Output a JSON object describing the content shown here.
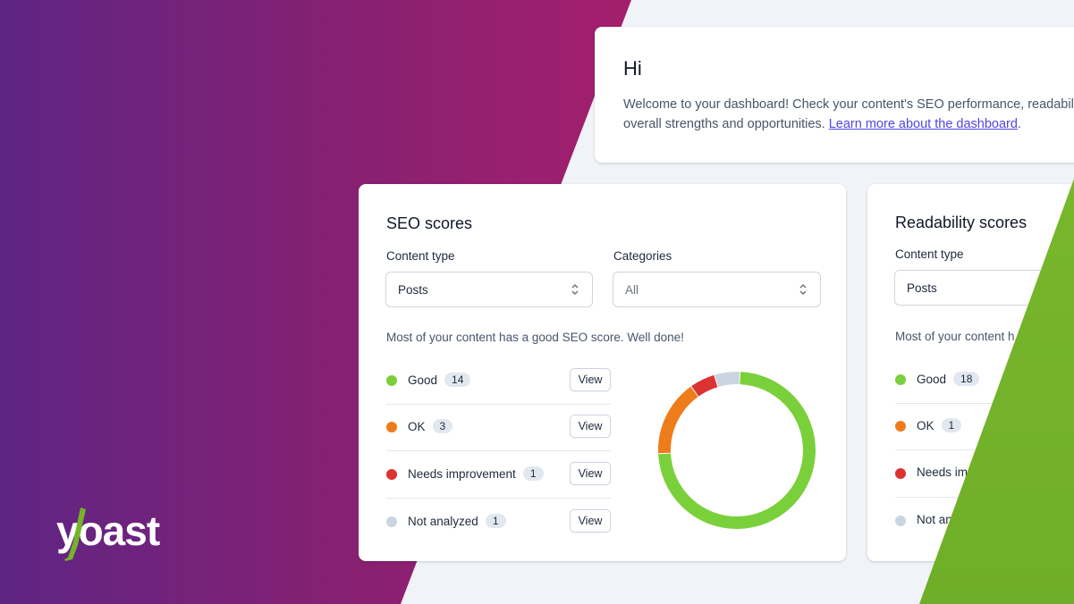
{
  "colors": {
    "good": "#7ad03a",
    "ok": "#ee7c1b",
    "bad": "#dc3232",
    "not_analyzed": "#cbd5e1",
    "brand_purple": "#a4286a",
    "brand_green": "#77b227",
    "link": "#4f46e5"
  },
  "logo": {
    "text": "yoast"
  },
  "welcome": {
    "title": "Hi",
    "text_line1": "Welcome to your dashboard! Check your content's SEO performance, readabili",
    "text_line2": "overall strengths and opportunities. ",
    "link_text": "Learn more about the dashboard",
    "link_suffix": "."
  },
  "seo": {
    "title": "SEO scores",
    "content_type_label": "Content type",
    "content_type_value": "Posts",
    "categories_label": "Categories",
    "categories_value": "All",
    "description": "Most of your content has a good SEO score. Well done!",
    "rows": [
      {
        "label": "Good",
        "count": "14",
        "button": "View",
        "icon": "good-dot"
      },
      {
        "label": "OK",
        "count": "3",
        "button": "View",
        "icon": "ok-dot"
      },
      {
        "label": "Needs improvement",
        "count": "1",
        "button": "View",
        "icon": "needs-improvement-dot"
      },
      {
        "label": "Not analyzed",
        "count": "1",
        "button": "View",
        "icon": "not-analyzed-dot"
      }
    ]
  },
  "readability": {
    "title": "Readability scores",
    "content_type_label": "Content type",
    "content_type_value": "Posts",
    "description": "Most of your content h",
    "rows": [
      {
        "label": "Good",
        "count": "18"
      },
      {
        "label": "OK",
        "count": "1"
      },
      {
        "label": "Needs im"
      },
      {
        "label": "Not an"
      }
    ]
  },
  "chart_data": {
    "type": "pie",
    "categories": [
      "Good",
      "OK",
      "Needs improvement",
      "Not analyzed"
    ],
    "values": [
      14,
      3,
      1,
      1
    ]
  }
}
